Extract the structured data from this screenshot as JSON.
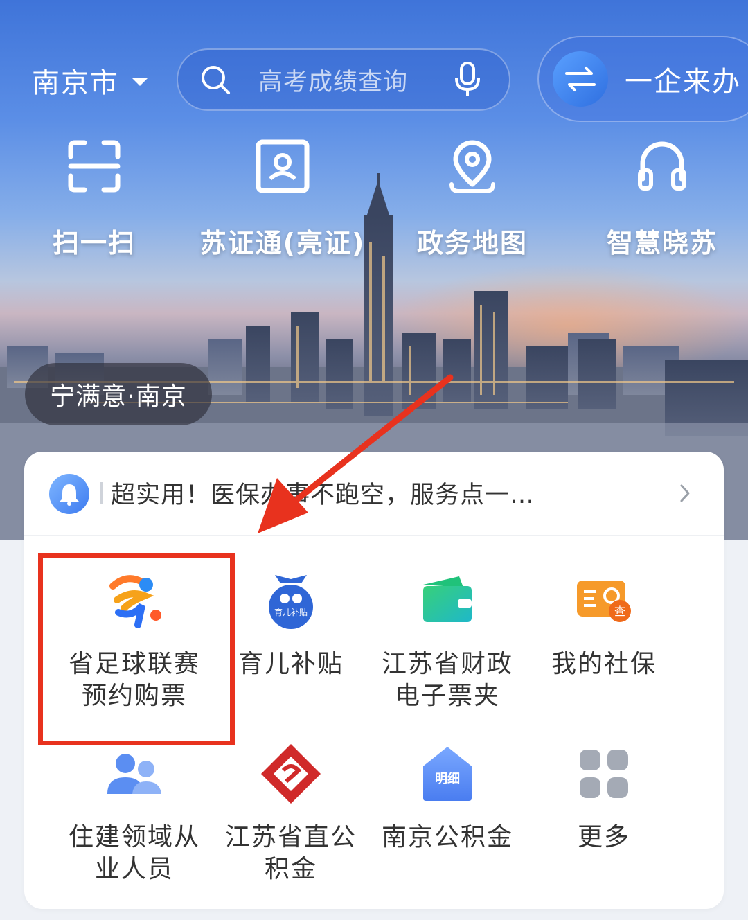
{
  "header": {
    "city": "南京市",
    "search_placeholder": "高考成绩查询",
    "enterprise_label": "一企来办"
  },
  "quick_actions": [
    {
      "label": "扫一扫",
      "icon": "scan-icon"
    },
    {
      "label": "苏证通(亮证)",
      "icon": "id-card-icon"
    },
    {
      "label": "政务地图",
      "icon": "map-pin-icon"
    },
    {
      "label": "智慧晓苏",
      "icon": "headset-icon"
    }
  ],
  "badge": "宁满意·南京",
  "notice": {
    "text": "超实用！医保办事不跑空，服务点一…",
    "icon": "bell-icon"
  },
  "services": [
    {
      "label": "省足球联赛\n预约购票",
      "icon": "football-league-icon"
    },
    {
      "label": "育儿补贴",
      "icon": "child-subsidy-icon",
      "icon_text": "育儿补贴"
    },
    {
      "label": "江苏省财政\n电子票夹",
      "icon": "wallet-icon"
    },
    {
      "label": "我的社保",
      "icon": "social-security-card-icon",
      "icon_text": "查"
    },
    {
      "label": "住建领域从\n业人员",
      "icon": "people-icon"
    },
    {
      "label": "江苏省直公\n积金",
      "icon": "provident-fund-logo-icon"
    },
    {
      "label": "南京公积金",
      "icon": "house-detail-icon",
      "icon_text": "明细"
    },
    {
      "label": "更多",
      "icon": "grid-more-icon"
    }
  ],
  "colors": {
    "highlight": "#e8321e",
    "accent_blue": "#3d7bf0"
  }
}
